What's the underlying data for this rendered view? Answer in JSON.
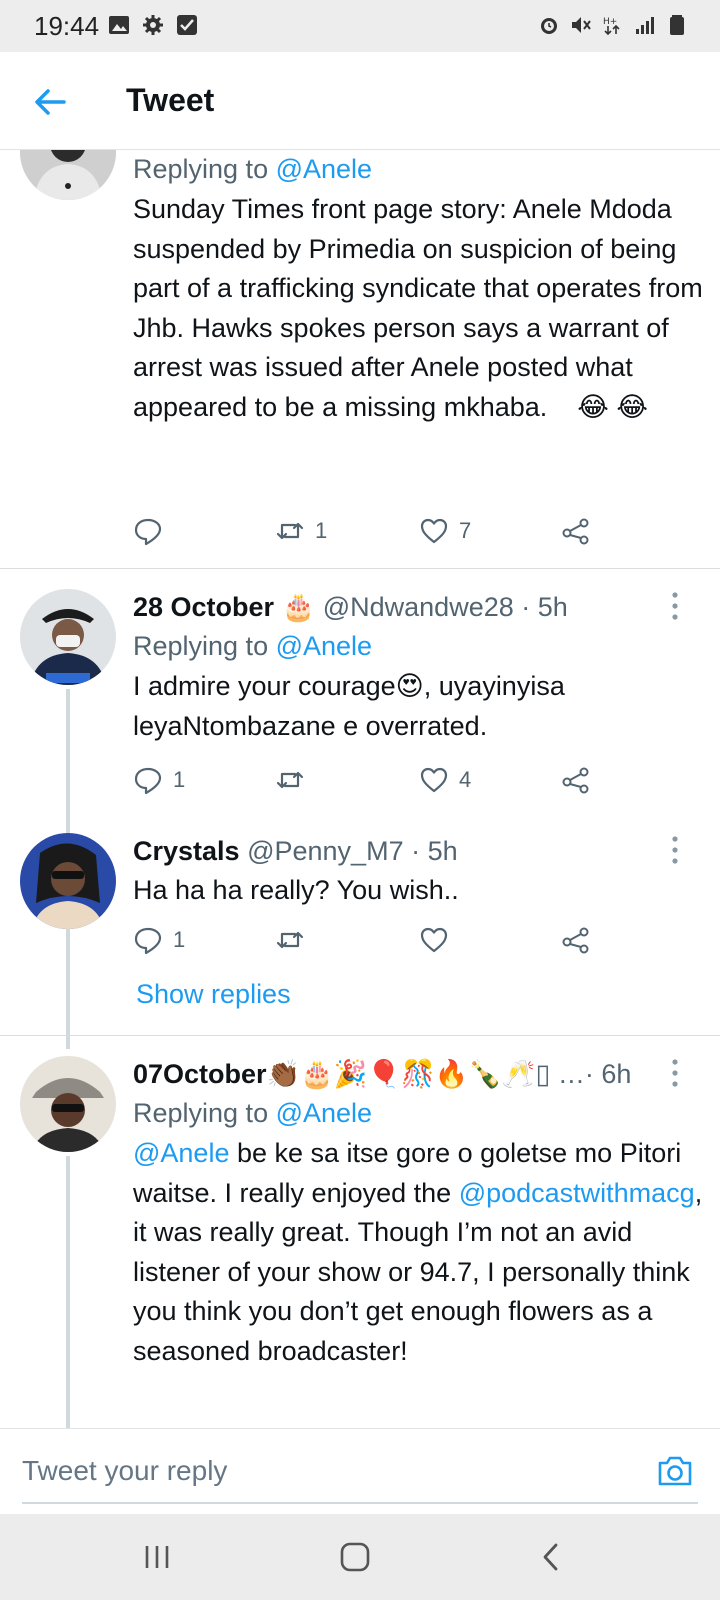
{
  "status_bar": {
    "time": "19:44"
  },
  "app_bar": {
    "title": "Tweet"
  },
  "tweets": [
    {
      "replying_prefix": "Replying to ",
      "replying_handle": "@Anele",
      "text": "Sunday Times front page story: Anele Mdoda suspended by Primedia on suspicion of being part of a trafficking syndicate that operates from Jhb. Hawks spokes person says a warrant of arrest was issued after Anele posted what appeared to be a missing mkhaba.",
      "emoji": "😂 😂",
      "retweets": "1",
      "likes": "7"
    },
    {
      "name": "28 October",
      "name_emoji": "🎂",
      "handle": "@Ndwandwe28",
      "time": "· 5h",
      "replying_prefix": "Replying to ",
      "replying_handle": "@Anele",
      "text": "I admire your courage😍, uyayinyisa leyaNtombazane e overrated.",
      "replies": "1",
      "likes": "4"
    },
    {
      "name": "Crystals",
      "handle": "@Penny_M7",
      "time": "· 5h",
      "text": "Ha ha ha really? You wish..",
      "replies": "1"
    },
    {
      "name": "07October",
      "name_emoji": "👏🏾🎂🎉🎈🎊🔥🍾🥂▯ …",
      "time": "· 6h",
      "replying_prefix": "Replying to ",
      "replying_handle": "@Anele",
      "text_mention_1": "@Anele",
      "text_part_1": " be ke sa itse gore o goletse mo Pitori waitse. I really enjoyed the ",
      "text_mention_2": "@podcastwithmacg",
      "text_part_2": ", it was really great. Though I’m not an avid listener of your show or 94.7, I personally think you think you don’t get enough flowers as a seasoned broadcaster!"
    }
  ],
  "show_replies": "Show replies",
  "reply_bar": {
    "placeholder": "Tweet your reply"
  },
  "colors": {
    "accent": "#1d9bf0",
    "text": "#0f1419",
    "secondary": "#536471",
    "thread_line": "#cfd9de"
  }
}
